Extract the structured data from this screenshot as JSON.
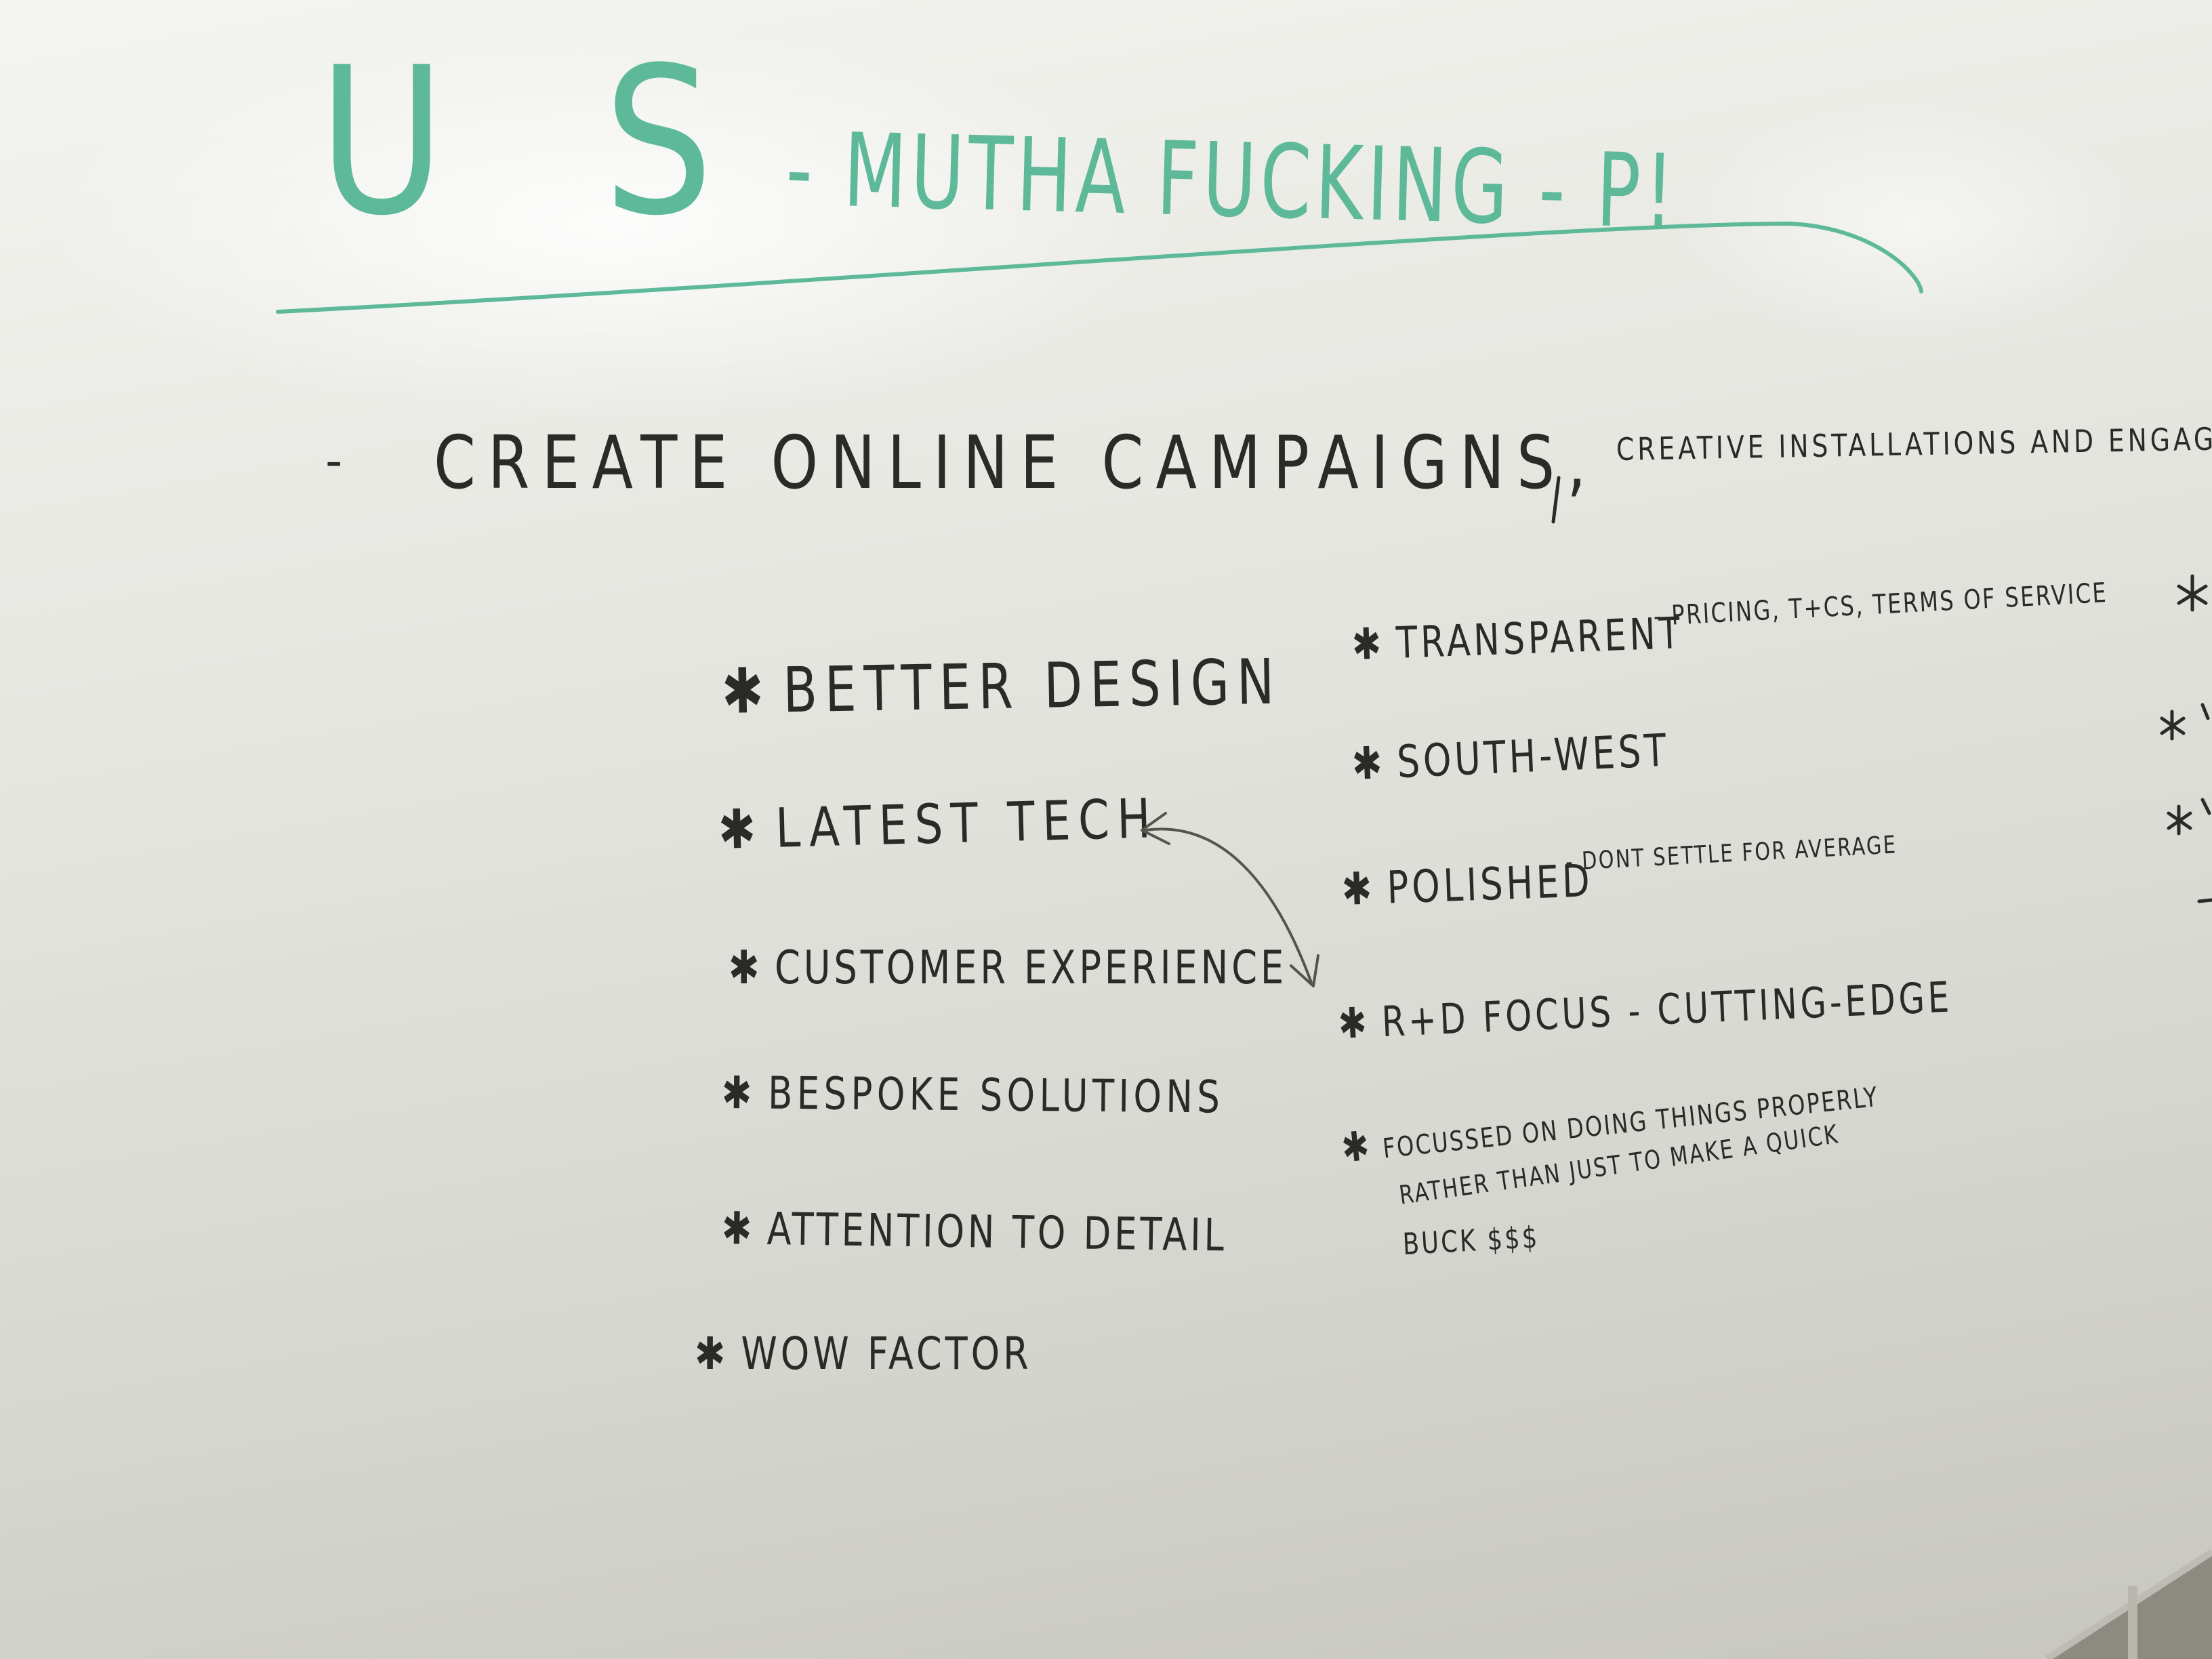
{
  "heading": {
    "part1": "U S",
    "part2": "- MUTHA FUCKING - P!"
  },
  "main_line": {
    "dash": "-",
    "big": "CREATE ONLINE CAMPAIGNS,",
    "small": "CREATIVE INSTALLATIONS AND ENGAGING"
  },
  "star_glyph": "✱",
  "left_items": [
    "BETTER DESIGN",
    "LATEST TECH",
    "CUSTOMER EXPERIENCE",
    "BESPOKE SOLUTIONS",
    "ATTENTION TO DETAIL",
    "WOW FACTOR"
  ],
  "right_items": {
    "transparent": {
      "main": "TRANSPARENT",
      "note": "- PRICING, T+CS, TERMS OF SERVICE"
    },
    "south_west": "SOUTH-WEST",
    "polished": {
      "main": "POLISHED",
      "note": "- DONT SETTLE FOR AVERAGE"
    },
    "rd_focus": "R+D FOCUS - CUTTING-EDGE",
    "focussed": {
      "line1": "FOCUSSED ON DOING THINGS PROPERLY",
      "line2": "RATHER THAN JUST TO MAKE A QUICK",
      "line3": "BUCK $$$"
    }
  },
  "colors": {
    "marker_black": "#2a2a28",
    "marker_green": "#5db99a",
    "board": "#e6e7e1"
  }
}
